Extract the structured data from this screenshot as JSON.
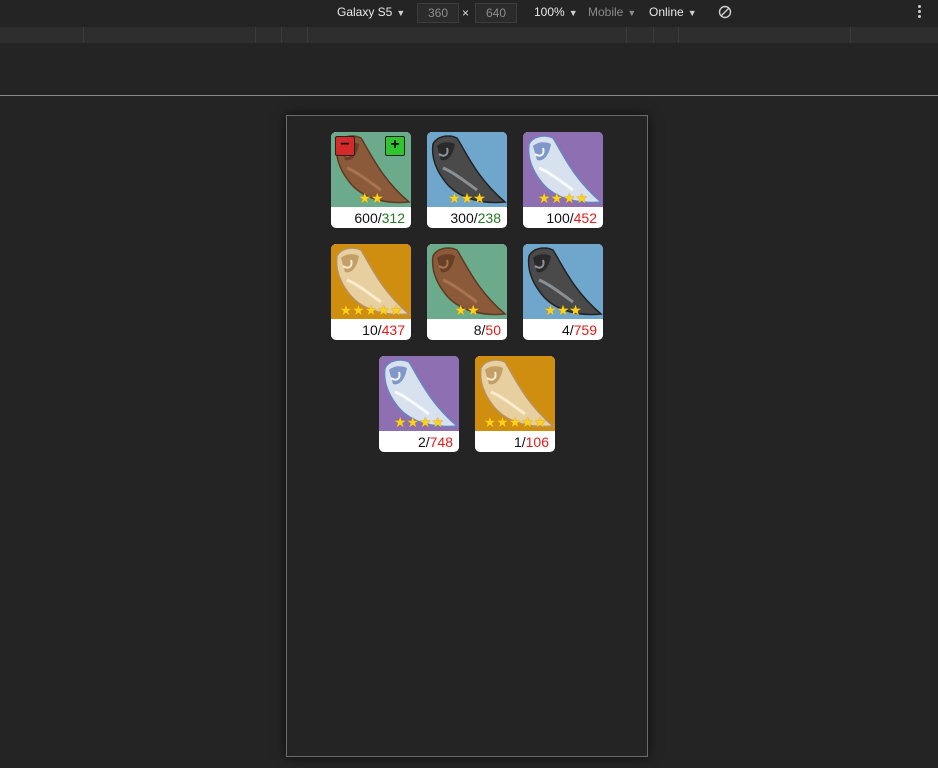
{
  "toolbar": {
    "device": "Galaxy S5",
    "width": "360",
    "height": "640",
    "times": "×",
    "zoom": "100%",
    "mode": "Mobile",
    "network": "Online",
    "caret": "▼"
  },
  "items": [
    {
      "owned": "600",
      "sep": "/",
      "need": "312",
      "stars": "★★",
      "bg": "green",
      "type": "brown",
      "status": "ok"
    },
    {
      "owned": "300",
      "sep": "/",
      "need": "238",
      "stars": "★★★",
      "bg": "blue",
      "type": "black",
      "status": "ok"
    },
    {
      "owned": "100",
      "sep": "/",
      "need": "452",
      "stars": "★★★★",
      "bg": "purple",
      "type": "white",
      "status": "bad"
    },
    {
      "owned": "10",
      "sep": "/",
      "need": "437",
      "stars": "★★★★★",
      "bg": "gold",
      "type": "gold",
      "status": "bad"
    },
    {
      "owned": "8",
      "sep": "/",
      "need": "50",
      "stars": "★★",
      "bg": "green",
      "type": "brown",
      "status": "bad"
    },
    {
      "owned": "4",
      "sep": "/",
      "need": "759",
      "stars": "★★★",
      "bg": "blue",
      "type": "black",
      "status": "bad"
    },
    {
      "owned": "2",
      "sep": "/",
      "need": "748",
      "stars": "★★★★",
      "bg": "purple",
      "type": "white",
      "status": "bad"
    },
    {
      "owned": "1",
      "sep": "/",
      "need": "106",
      "stars": "★★★★★",
      "bg": "gold",
      "type": "gold",
      "status": "bad"
    }
  ],
  "controls": {
    "minus": "−",
    "plus": "+"
  },
  "colors": {
    "ok": "#217a21",
    "bad": "#e21b1b",
    "star": "#ffd21a"
  }
}
